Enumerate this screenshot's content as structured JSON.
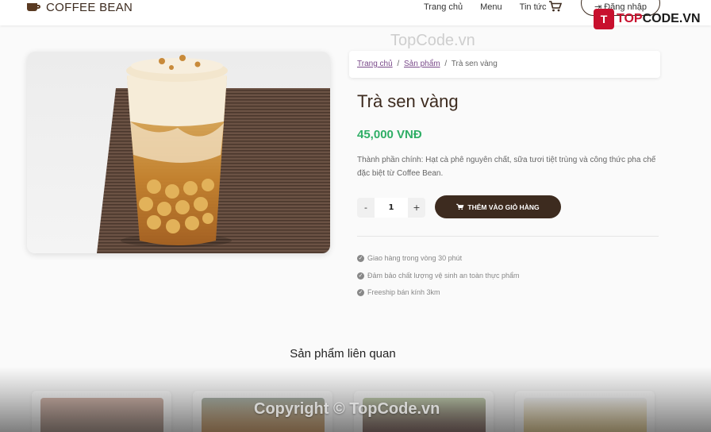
{
  "header": {
    "brand": "COFFEE BEAN",
    "nav": [
      "Trang chủ",
      "Menu",
      "Tin tức"
    ],
    "login_label": "Đăng nhập"
  },
  "watermark": {
    "top_text": "TopCode.vn",
    "logo_text_accent": "TOP",
    "logo_text_rest": "CODE.VN",
    "bottom_text": "Copyright © TopCode.vn"
  },
  "breadcrumb": {
    "home": "Trang chủ",
    "products": "Sản phẩm",
    "current": "Trà sen vàng",
    "separator": "/"
  },
  "product": {
    "name": "Trà sen vàng",
    "price": "45,000 VNĐ",
    "description": "Thành phần chính: Hạt cà phê nguyên chất, sữa tươi tiệt trùng và công thức pha chế đặc biệt từ Coffee Bean.",
    "quantity": "1",
    "decrement": "-",
    "increment": "+",
    "add_to_cart": "THÊM VÀO GIỎ HÀNG"
  },
  "features": [
    "Giao hàng trong vòng 30 phút",
    "Đảm bảo chất lượng vệ sinh an toàn thực phẩm",
    "Freeship bán kính 3km"
  ],
  "related_title": "Sản phẩm liên quan",
  "colors": {
    "brand": "#3d2b1f",
    "price": "#2fae66",
    "link": "#7a4a8a"
  }
}
